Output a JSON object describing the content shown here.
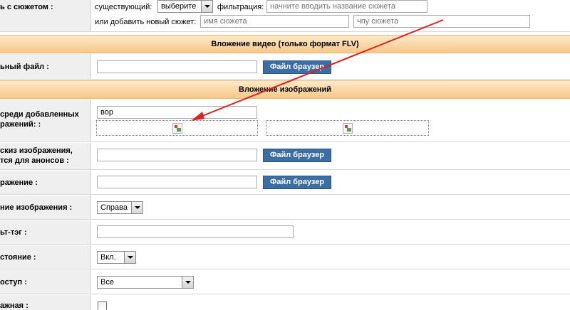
{
  "plot": {
    "label": "ь с сюжетом :",
    "existing_label": "существующий:",
    "existing_select": "выберите",
    "filter_label": "фильтрация:",
    "filter_placeholder": "начните вводить название сюжета",
    "add_label": "или добавить новый сюжет:",
    "name_placeholder": "имя сюжета",
    "chpu_placeholder": "чпу сюжета"
  },
  "video_section": {
    "title": "Вложение видео (только формат FLV)"
  },
  "video_file": {
    "label": "ьный файл :",
    "button": "Файл браузер"
  },
  "image_section": {
    "title": "Вложение изображений"
  },
  "image_select": {
    "label_line1": "среди добавленных",
    "label_line2": "ражений: :",
    "input_value": "вор"
  },
  "sketch": {
    "label_line1": "скиз изображения,",
    "label_line2": "тся для анонсов :",
    "button": "Файл браузер"
  },
  "image": {
    "label": "ражение :",
    "button": "Файл браузер"
  },
  "alignment": {
    "label": "ние изображения :",
    "value": "Справа"
  },
  "alt_tag": {
    "label": "ьт-тэг :"
  },
  "status": {
    "label": "стояние :",
    "value": "Вкл."
  },
  "access": {
    "label": "оступ :",
    "value": "Все"
  },
  "important": {
    "label": "ажная :"
  },
  "colors": {
    "annotation_arrow": "#e02020",
    "section_bg": "#f7c88a",
    "button_bg": "#3b6ea5"
  }
}
